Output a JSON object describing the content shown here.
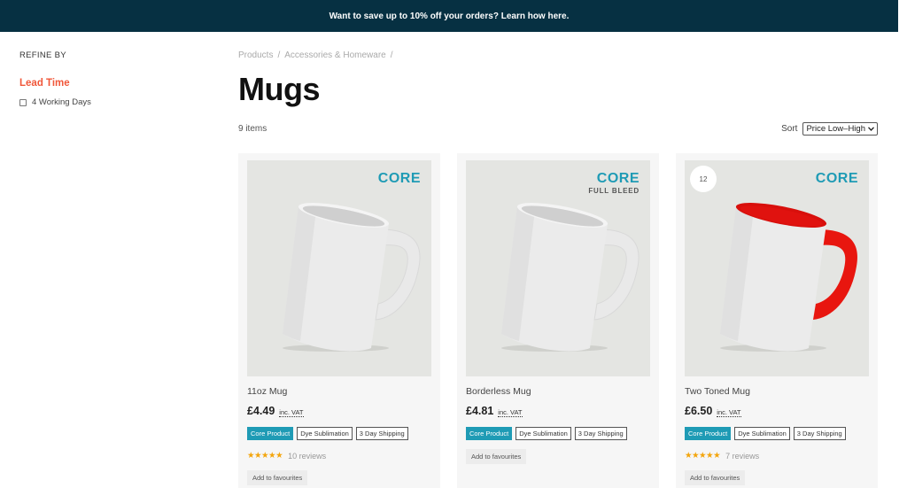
{
  "banner": {
    "text": "Want to save up to 10% off your orders? Learn how here."
  },
  "sidebar": {
    "refine_label": "REFINE BY",
    "facet_title": "Lead Time",
    "options": [
      {
        "label": "4 Working Days",
        "checked": false
      }
    ]
  },
  "breadcrumb": {
    "items": [
      "Products",
      "Accessories & Homeware"
    ],
    "separator": "/"
  },
  "page": {
    "title": "Mugs",
    "item_count": "9 items"
  },
  "sort": {
    "label": "Sort",
    "selected": "Price Low–High"
  },
  "products": [
    {
      "name": "11oz Mug",
      "price": "£4.49",
      "vat": "inc. VAT",
      "logo": "CORE",
      "logo_sub": "",
      "tags": [
        "Core Product",
        "Dye Sublimation",
        "3 Day Shipping"
      ],
      "rating": "★★★★★",
      "reviews": "10 reviews",
      "favourite_label": "Add to favourites",
      "mug_inner": "#cfcfcf",
      "mug_handle": "#e8e8e8"
    },
    {
      "name": "Borderless Mug",
      "price": "£4.81",
      "vat": "inc. VAT",
      "logo": "CORE",
      "logo_sub": "FULL BLEED",
      "tags": [
        "Core Product",
        "Dye Sublimation",
        "3 Day Shipping"
      ],
      "rating": "",
      "reviews": "",
      "favourite_label": "Add to favourites",
      "mug_inner": "#cfcfcf",
      "mug_handle": "#e8e8e8"
    },
    {
      "name": "Two Toned Mug",
      "price": "£6.50",
      "vat": "inc. VAT",
      "logo": "CORE",
      "logo_sub": "",
      "badge": "12",
      "tags": [
        "Core Product",
        "Dye Sublimation",
        "3 Day Shipping"
      ],
      "rating": "★★★★★",
      "reviews": "7 reviews",
      "favourite_label": "Add to favourites",
      "mug_inner": "#e0120f",
      "mug_handle": "#e8160f"
    }
  ],
  "colors": {
    "banner_bg": "#063042",
    "accent": "#f0573a",
    "core_blue": "#1f9bb5",
    "star": "#f3a50c"
  }
}
